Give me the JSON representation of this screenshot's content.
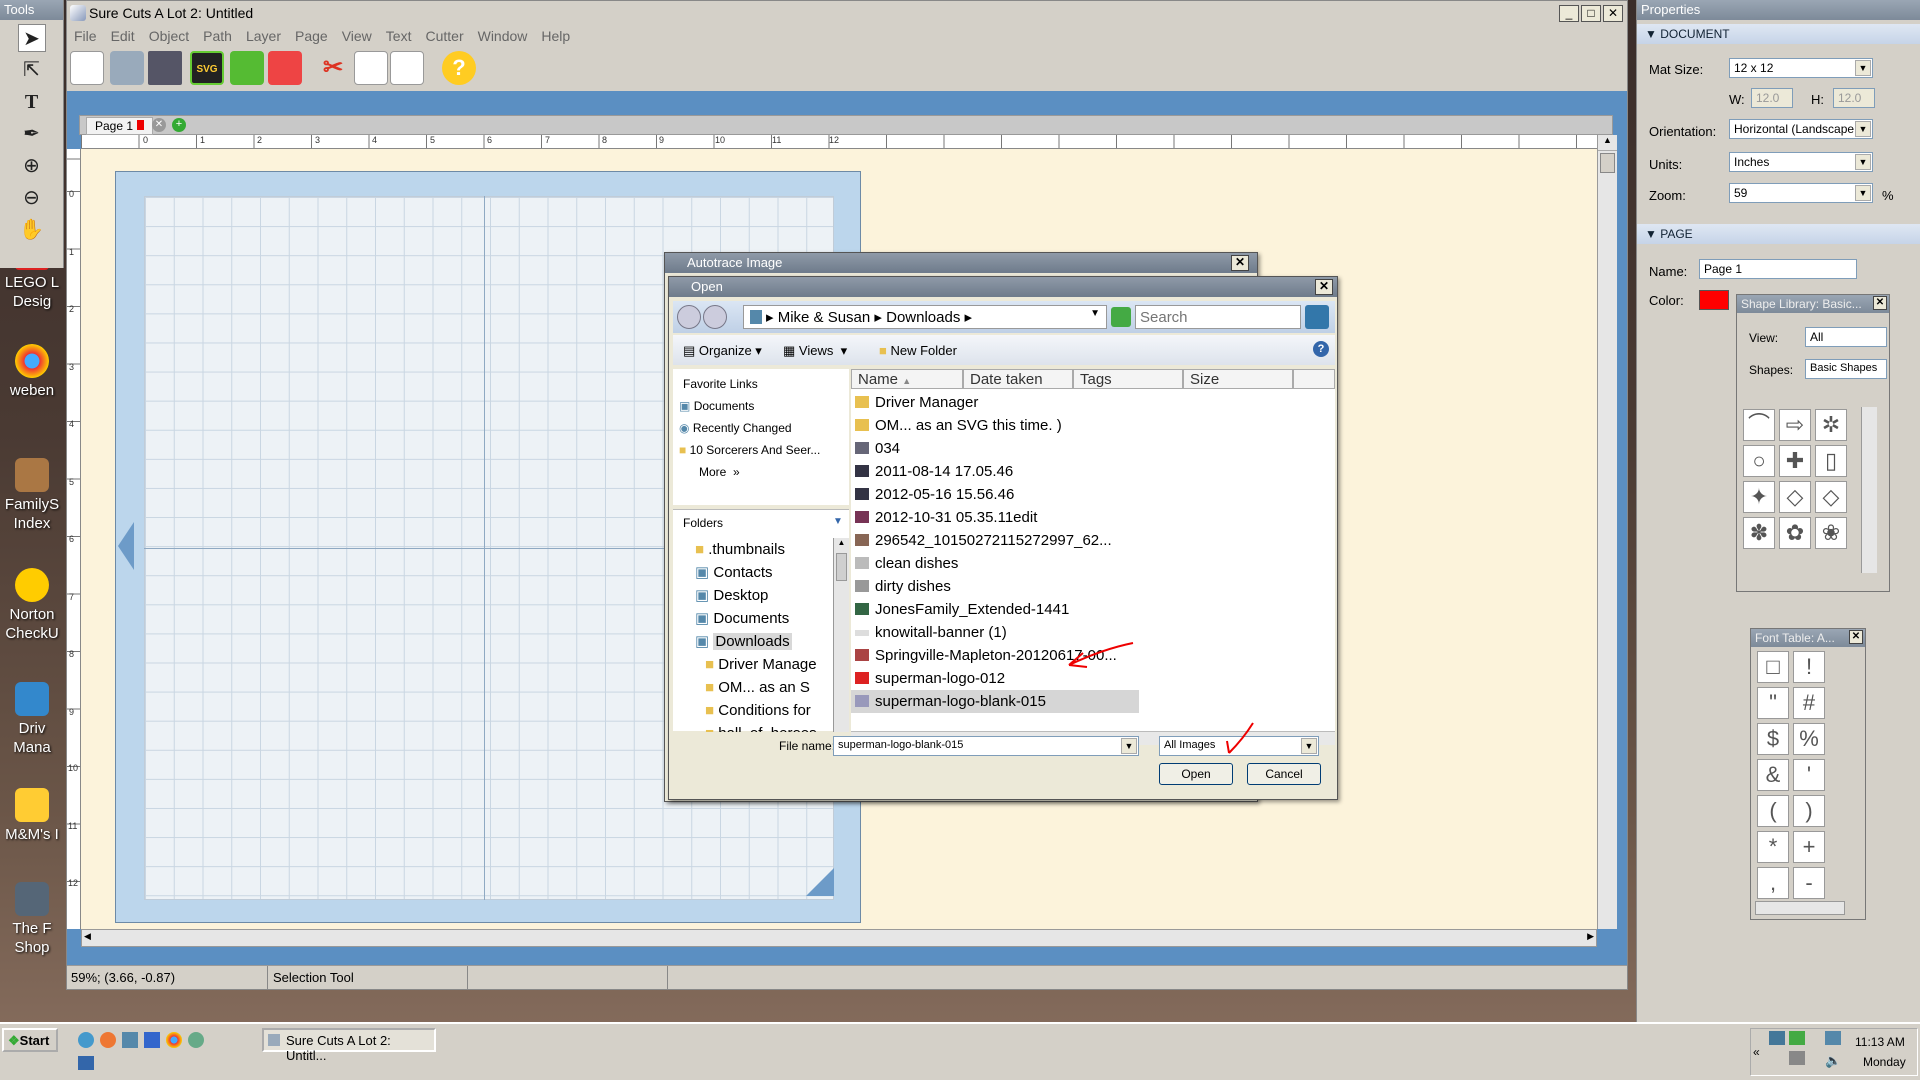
{
  "desktop": {
    "icons": [
      {
        "label": "LEGO L\nDesig",
        "color": "#d22"
      },
      {
        "label": "weben",
        "color": "#e84"
      },
      {
        "label": "FamilyS\nIndex",
        "color": "#a74"
      },
      {
        "label": "Norton\nCheckU",
        "color": "#fc0"
      },
      {
        "label": "Driv\nMana",
        "color": "#38c"
      },
      {
        "label": "M&M's I",
        "color": "#fc3"
      },
      {
        "label": "The F\nShop",
        "color": "#567"
      }
    ]
  },
  "tools_panel": {
    "title": "Tools"
  },
  "app": {
    "title": "Sure Cuts A Lot 2: Untitled",
    "menu": [
      "File",
      "Edit",
      "Object",
      "Path",
      "Layer",
      "Page",
      "View",
      "Text",
      "Cutter",
      "Window",
      "Help"
    ],
    "toolbar": {
      "svg_label": "SVG",
      "help_label": "?"
    },
    "page_tab": "Page 1",
    "status": {
      "zoom_coords": "59%; (3.66, -0.87)",
      "tool": "Selection Tool"
    },
    "ruler_h": [
      "0",
      "1",
      "2",
      "3",
      "4",
      "5",
      "6",
      "7",
      "8",
      "9",
      "10",
      "11",
      "12"
    ],
    "ruler_v": [
      "0",
      "1",
      "2",
      "3",
      "4",
      "5",
      "6",
      "7",
      "8",
      "9",
      "10",
      "11",
      "12"
    ]
  },
  "properties": {
    "title": "Properties",
    "document": {
      "header": "DOCUMENT",
      "mat_size_label": "Mat Size:",
      "mat_size": "12 x 12",
      "w_label": "W:",
      "w": "12.0",
      "h_label": "H:",
      "h": "12.0",
      "orientation_label": "Orientation:",
      "orientation": "Horizontal (Landscape",
      "units_label": "Units:",
      "units": "Inches",
      "zoom_label": "Zoom:",
      "zoom": "59",
      "zoom_unit": "%"
    },
    "page": {
      "header": "PAGE",
      "name_label": "Name:",
      "name": "Page 1",
      "color_label": "Color:",
      "color": "#ff0000"
    }
  },
  "shape_library": {
    "title": "Shape Library: Basic...",
    "view_label": "View:",
    "view": "All",
    "shapes_label": "Shapes:",
    "shapes": "Basic Shapes",
    "items": [
      "⌒",
      "⇨",
      "✲",
      "○",
      "✚",
      "▯",
      "✦",
      "◇",
      "◇",
      "✽",
      "✿",
      "❀"
    ]
  },
  "font_table": {
    "title": "Font Table: A...",
    "items": [
      "□",
      "!",
      "\"",
      "#",
      "$",
      "%",
      "&",
      "'",
      "(",
      ")",
      "*",
      "+",
      ",",
      "-"
    ]
  },
  "autotrace": {
    "title": "Autotrace Image"
  },
  "open_dialog": {
    "title": "Open",
    "breadcrumb": [
      "Mike & Susan",
      "Downloads"
    ],
    "search_placeholder": "Search",
    "commands": {
      "organize": "Organize",
      "views": "Views",
      "new_folder": "New Folder"
    },
    "favorites_header": "Favorite Links",
    "favorites": [
      "Documents",
      "Recently Changed",
      "10 Sorcerers And Seer...",
      "More"
    ],
    "folders_header": "Folders",
    "folders": [
      ".thumbnails",
      "Contacts",
      "Desktop",
      "Documents",
      "Downloads",
      "Driver Manage",
      "OM... as an S",
      "Conditions for",
      "hall_of_heroes"
    ],
    "columns": [
      "Name",
      "Date taken",
      "Tags",
      "Size"
    ],
    "files": [
      "Driver Manager",
      "OM... as an SVG this time. )",
      "034",
      "2011-08-14 17.05.46",
      "2012-05-16 15.56.46",
      "2012-10-31 05.35.11edit",
      "296542_10150272115272997_62...",
      "clean dishes",
      "dirty dishes",
      "JonesFamily_Extended-1441",
      "knowitall-banner (1)",
      "Springville-Mapleton-20120617-00...",
      "superman-logo-012",
      "superman-logo-blank-015"
    ],
    "file_name_label": "File name:",
    "file_name": "superman-logo-blank-015",
    "file_type": "All Images",
    "open_button": "Open",
    "cancel_button": "Cancel"
  },
  "taskbar": {
    "start": "Start",
    "task": "Sure Cuts A Lot 2: Untitl...",
    "time": "11:13 AM",
    "day": "Monday"
  }
}
